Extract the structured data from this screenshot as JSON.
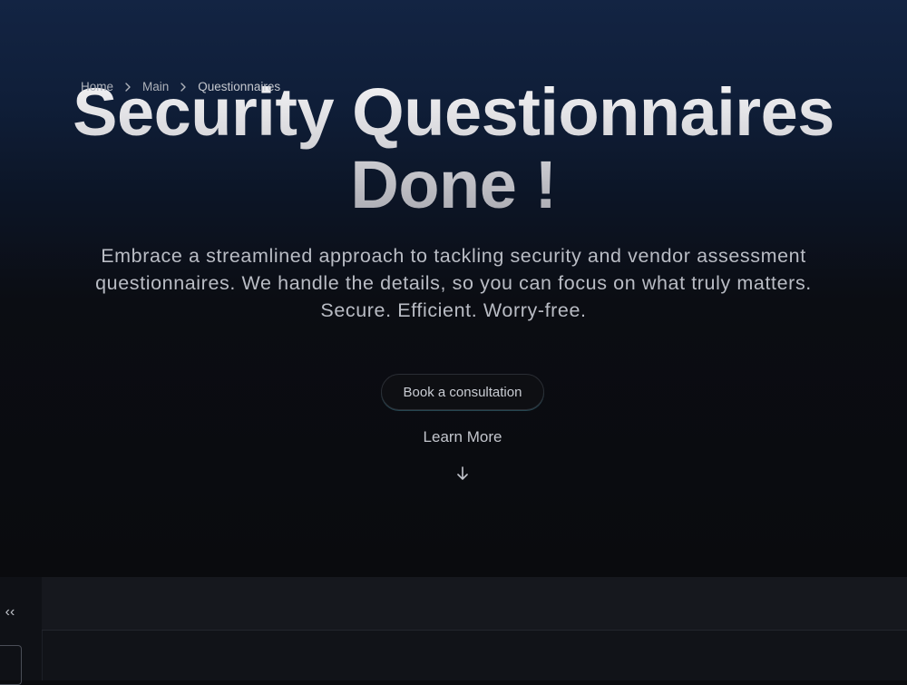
{
  "hero": {
    "title_line1": "Security Questionnaires",
    "title_line2": "Done !",
    "subtitle_line1": "Embrace a streamlined approach to tackling security and vendor assessment",
    "subtitle_line2": "questionnaires. We handle the details, so you can focus on what truly matters.",
    "subtitle_line3": "Secure. Efficient. Worry-free.",
    "cta_label": "Book a consultation",
    "learn_more_label": "Learn More",
    "learn_more_icon": "arrow-down-icon"
  },
  "sidebar": {
    "collapse_icon": "double-chevron-left-icon",
    "collapse_glyph": "‹‹"
  },
  "breadcrumb": {
    "items": [
      "Home",
      "Main",
      "Questionnaires"
    ],
    "separator_icon": "chevron-right-icon"
  },
  "colors": {
    "hero_top": "#132443",
    "background": "#0a0b0e",
    "text_muted": "#b9bcc4",
    "cta_glow": "#5ab4c8"
  }
}
